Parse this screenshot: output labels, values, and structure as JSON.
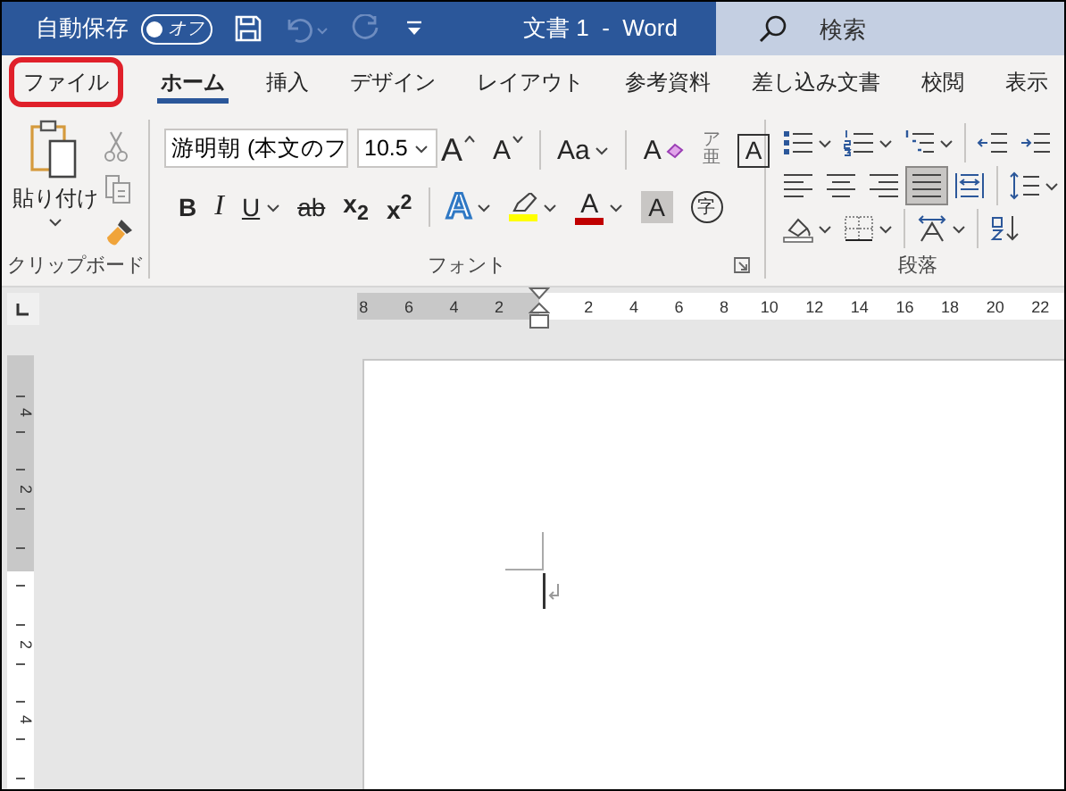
{
  "title_bar": {
    "autosave_label": "自動保存",
    "autosave": {
      "on": false,
      "label": "オフ"
    },
    "quick_access": [
      {
        "kind": "save",
        "disabled": false
      },
      {
        "kind": "undo",
        "disabled": true
      },
      {
        "kind": "redo",
        "disabled": true
      },
      {
        "kind": "customize",
        "disabled": false
      }
    ],
    "title": "文書 1  -  Word",
    "search": {
      "placeholder": "検索"
    }
  },
  "tabs": [
    {
      "label": "ファイル",
      "selected": false,
      "highlighted": true
    },
    {
      "label": "ホーム",
      "selected": true,
      "highlighted": false
    },
    {
      "label": "挿入",
      "selected": false,
      "highlighted": false
    },
    {
      "label": "デザイン",
      "selected": false,
      "highlighted": false
    },
    {
      "label": "レイアウト",
      "selected": false,
      "highlighted": false
    },
    {
      "label": "参考資料",
      "selected": false,
      "highlighted": false
    },
    {
      "label": "差し込み文書",
      "selected": false,
      "highlighted": false
    },
    {
      "label": "校閲",
      "selected": false,
      "highlighted": false
    },
    {
      "label": "表示",
      "selected": false,
      "highlighted": false
    }
  ],
  "ribbon": {
    "clipboard": {
      "paste_label": "貼り付け",
      "label": "クリップボード"
    },
    "font": {
      "font_name": "游明朝 (本文のフ",
      "font_size": "10.5",
      "row_1": [
        {
          "kind": "grow",
          "label": "A",
          "dropdown": false
        },
        {
          "kind": "shrink",
          "label": "A",
          "dropdown": false
        },
        {
          "kind": "case",
          "label": "Aa",
          "dropdown": true
        },
        {
          "kind": "clear",
          "label": "A",
          "dropdown": false
        },
        {
          "kind": "ruby",
          "label": "亜",
          "ruby": "ア",
          "dropdown": false
        },
        {
          "kind": "boxed",
          "label": "A",
          "dropdown": false
        }
      ],
      "row_2": [
        {
          "kind": "bold",
          "label": "B",
          "dropdown": false
        },
        {
          "kind": "italic",
          "label": "I",
          "dropdown": false
        },
        {
          "kind": "underline",
          "label": "U",
          "dropdown": true
        },
        {
          "kind": "strike",
          "label": "ab",
          "dropdown": false
        },
        {
          "kind": "subscript",
          "label": "x$_{2}$",
          "dropdown": false
        },
        {
          "kind": "superscript",
          "label": "x$^{2}$",
          "dropdown": false
        },
        {
          "kind": "effects",
          "label": "A",
          "dropdown": true
        },
        {
          "kind": "highlight",
          "color": "#ffff00",
          "dropdown": true
        },
        {
          "kind": "font_color",
          "label": "A",
          "color": "#c00000",
          "dropdown": true
        },
        {
          "kind": "shading",
          "label": "A",
          "dropdown": false
        },
        {
          "kind": "enclosed",
          "label": "字",
          "dropdown": false
        }
      ],
      "label": "フォント"
    },
    "paragraph": {
      "row_1": [
        {
          "kind": "bullets",
          "dropdown": true
        },
        {
          "kind": "numbering",
          "dropdown": true
        },
        {
          "kind": "multilevel",
          "dropdown": true
        },
        {
          "kind": "outdent",
          "dropdown": false
        },
        {
          "kind": "indent",
          "dropdown": false
        }
      ],
      "row_2": [
        {
          "kind": "align_left",
          "dropdown": false,
          "selected": false
        },
        {
          "kind": "align_center",
          "dropdown": false,
          "selected": false
        },
        {
          "kind": "align_right",
          "dropdown": false,
          "selected": false
        },
        {
          "kind": "justify",
          "dropdown": false,
          "selected": true
        },
        {
          "kind": "distribute",
          "dropdown": false,
          "selected": false
        },
        {
          "kind": "line_spacing",
          "dropdown": true,
          "selected": false
        }
      ],
      "row_3": [
        {
          "kind": "shading",
          "dropdown": true
        },
        {
          "kind": "borders",
          "dropdown": true
        },
        {
          "kind": "text_direction",
          "dropdown": true
        },
        {
          "kind": "sort",
          "dropdown": false
        }
      ],
      "label": "段落"
    }
  },
  "ruler": {
    "left_numbers": [
      "8",
      "6",
      "4",
      "2"
    ],
    "right_numbers": [
      "2",
      "4",
      "6",
      "8",
      "10",
      "12",
      "14",
      "16",
      "18",
      "20",
      "22"
    ]
  },
  "vertical_ruler": {
    "top_numbers": [
      "4",
      "2"
    ],
    "bottom_numbers": [
      "2",
      "4"
    ]
  }
}
